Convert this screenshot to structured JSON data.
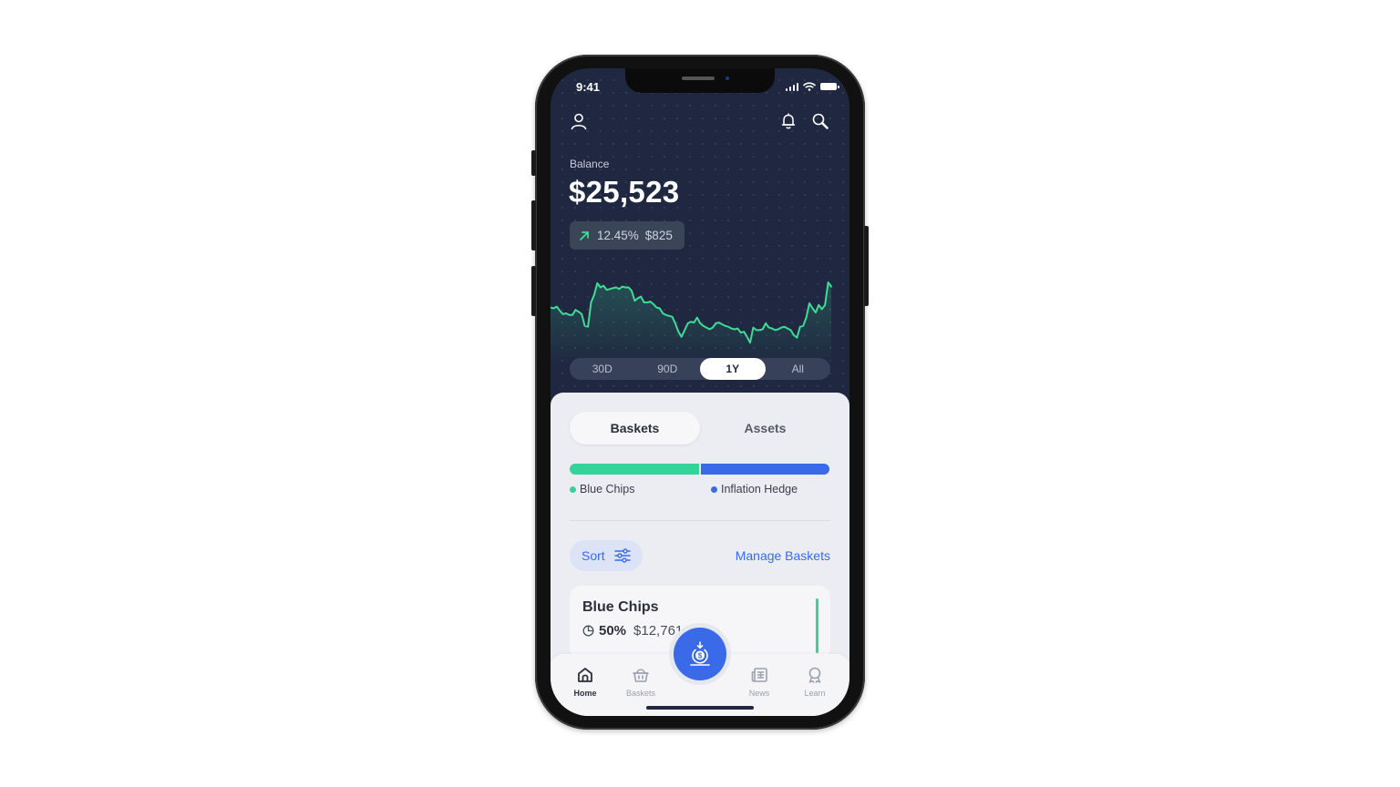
{
  "status_bar": {
    "time": "9:41"
  },
  "header": {
    "balance_label": "Balance",
    "balance_value": "$25,523",
    "change_percent": "12.45%",
    "change_amount": "$825",
    "up_color": "#3ddc97"
  },
  "chart_data": {
    "type": "line",
    "title": "",
    "xlabel": "",
    "ylabel": "",
    "period": "1Y",
    "values": [
      57,
      56,
      58,
      53,
      49,
      50,
      48,
      48,
      54,
      52,
      49,
      35,
      34,
      63,
      72,
      86,
      81,
      83,
      78,
      79,
      80,
      81,
      79,
      82,
      81,
      81,
      77,
      65,
      68,
      70,
      63,
      63,
      64,
      61,
      57,
      56,
      50,
      48,
      47,
      46,
      38,
      28,
      22,
      30,
      38,
      40,
      39,
      45,
      38,
      35,
      33,
      31,
      33,
      38,
      39,
      37,
      35,
      34,
      32,
      31,
      32,
      27,
      28,
      22,
      15,
      33,
      30,
      30,
      31,
      38,
      33,
      32,
      30,
      31,
      33,
      34,
      32,
      30,
      24,
      21,
      34,
      35,
      45,
      62,
      56,
      51,
      60,
      55,
      60,
      87,
      82
    ],
    "ylim": [
      0,
      100
    ],
    "line_color": "#3ddc97",
    "grid": false
  },
  "periods": [
    {
      "label": "30D",
      "active": false
    },
    {
      "label": "90D",
      "active": false
    },
    {
      "label": "1Y",
      "active": true
    },
    {
      "label": "All",
      "active": false
    }
  ],
  "segment_tabs": [
    {
      "label": "Baskets",
      "active": true
    },
    {
      "label": "Assets",
      "active": false
    }
  ],
  "allocation": [
    {
      "name": "Blue Chips",
      "percent": 50,
      "color": "#34d399"
    },
    {
      "name": "Inflation Hedge",
      "percent": 50,
      "color": "#3a6ae8"
    }
  ],
  "actions": {
    "sort_label": "Sort",
    "manage_label": "Manage Baskets"
  },
  "baskets": [
    {
      "name": "Blue Chips",
      "percent": "50%",
      "amount": "$12,761",
      "accent": "#34d399"
    }
  ],
  "tabbar": [
    {
      "label": "Home",
      "active": true
    },
    {
      "label": "Baskets",
      "active": false
    },
    {
      "label": "News",
      "active": false
    },
    {
      "label": "Learn",
      "active": false
    }
  ]
}
